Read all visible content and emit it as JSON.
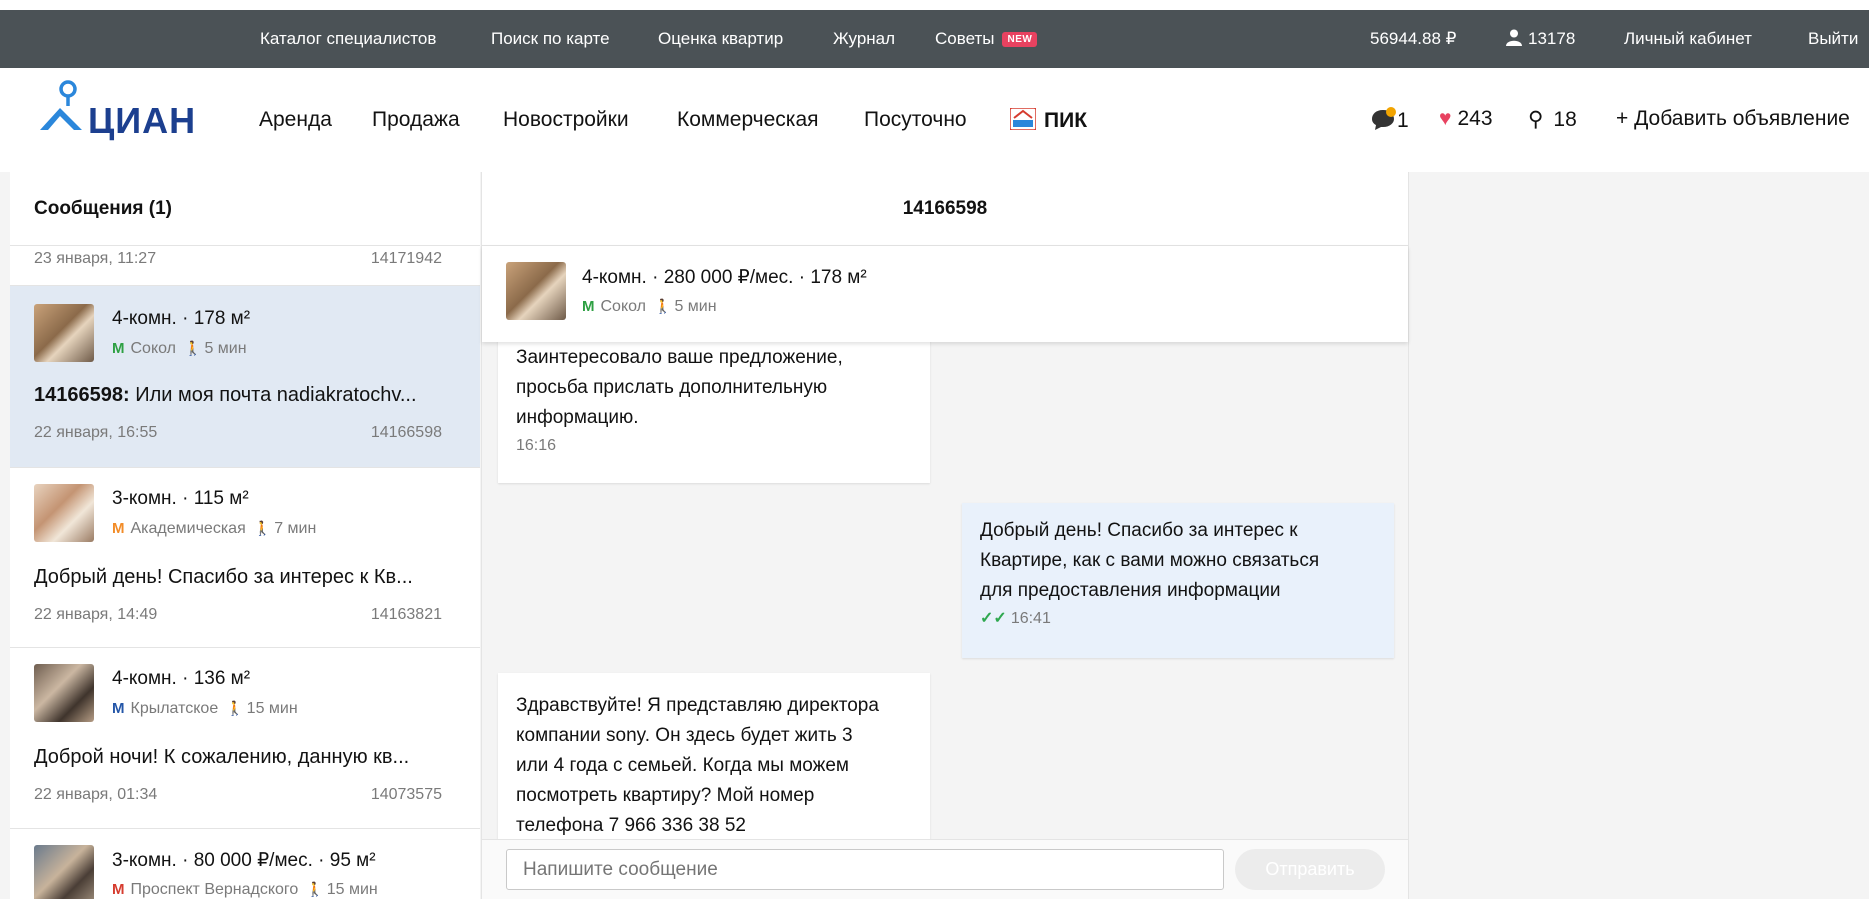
{
  "topbar": {
    "items": [
      "Каталог специалистов",
      "Поиск по карте",
      "Оценка квартир",
      "Журнал",
      "Советы"
    ],
    "new_badge": "NEW",
    "balance": "56944.88 ₽",
    "user_id": "13178",
    "cabinet": "Личный кабинет",
    "logout": "Выйти"
  },
  "nav": {
    "logo_text": "ЦИАН",
    "items": [
      "Аренда",
      "Продажа",
      "Новостройки",
      "Коммерческая",
      "Посуточно",
      "ПИК"
    ],
    "messages_count": "1",
    "favorites_count": "243",
    "compare_count": "18",
    "add_listing": "+ Добавить объявление"
  },
  "left": {
    "title": "Сообщения (1)",
    "partial": {
      "date": "23 января, 11:27",
      "id": "14171942"
    },
    "conversations": [
      {
        "title": "4-комн. · 178 м²",
        "metro": "Сокол",
        "walk": "5 мин",
        "metro_color": "#2ea043",
        "message_id": "14166598:",
        "message": " Или моя почта nadiakratochv...",
        "date": "22 января, 16:55",
        "id": "14166598",
        "active": true
      },
      {
        "title": "3-комн. · 115 м²",
        "metro": "Академическая",
        "walk": "7 мин",
        "metro_color": "#f28c28",
        "message": "Добрый день! Спасибо за интерес к Кв...",
        "date": "22 января, 14:49",
        "id": "14163821"
      },
      {
        "title": "4-комн. · 136 м²",
        "metro": "Крылатское",
        "walk": "15 мин",
        "metro_color": "#2456a8",
        "message": "Доброй ночи! К сожалению, данную кв...",
        "date": "22 января, 01:34",
        "id": "14073575"
      },
      {
        "title": "3-комн. · 80 000 ₽/мес. · 95 м²",
        "metro": "Проспект Вернадского",
        "walk": "15 мин",
        "metro_color": "#d63c2f"
      }
    ]
  },
  "chat": {
    "title": "14166598",
    "offer": {
      "title": "4-комн. · 280 000 ₽/мес. · 178 м²",
      "metro": "Сокол",
      "walk": "5 мин"
    },
    "messages": [
      {
        "lines": [
          "Заинтересовало ваше предложение,",
          "просьба прислать дополнительную",
          "информацию."
        ],
        "time": "16:16",
        "direction": "in"
      },
      {
        "lines": [
          "Добрый день! Спасибо за интерес к",
          "Квартире, как с вами можно связаться",
          "для предоставления информации"
        ],
        "time": "16:41",
        "direction": "out"
      },
      {
        "lines": [
          "Здравствуйте! Я представляю директора",
          "компании sony. Он здесь будет жить 3",
          "или 4 года с семьей. Когда мы можем",
          "посмотреть квартиру? Мой номер",
          "телефона 7 966 336 38 52"
        ],
        "direction": "in"
      }
    ],
    "input_placeholder": "Напишите сообщение",
    "send": "Отправить"
  },
  "colors": {
    "topbar": "#4b5256",
    "accent": "#2b87db",
    "active_row": "#e1e9f3",
    "outgoing": "#e9f1fb",
    "heart": "#e84260"
  }
}
